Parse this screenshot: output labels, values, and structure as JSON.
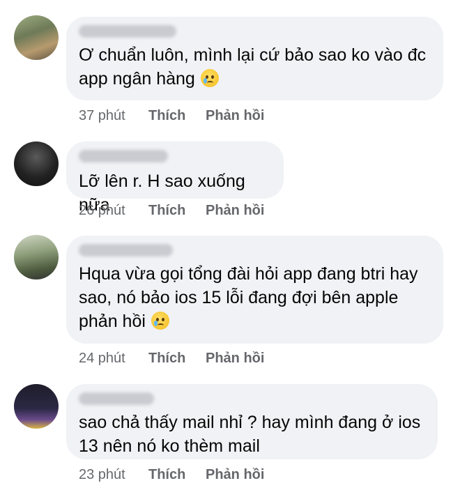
{
  "comments": [
    {
      "text_lines": [
        "Ơ chuẩn luôn, mình lại cứ bảo sao ko vào đc",
        "app ngân hàng"
      ],
      "emoji": "crying-face-emoji",
      "time": "37 phút",
      "like_label": "Thích",
      "reply_label": "Phản hồi"
    },
    {
      "text_lines": [
        "Lỡ lên r. H sao xuống nữa"
      ],
      "time": "26 phút",
      "like_label": "Thích",
      "reply_label": "Phản hồi"
    },
    {
      "text_lines": [
        "Hqua vừa gọi tổng đài hỏi app đang btri hay",
        "sao, nó bảo ios 15 lỗi đang đợi bên apple",
        "phản hồi"
      ],
      "emoji": "crying-face-emoji",
      "time": "24 phút",
      "like_label": "Thích",
      "reply_label": "Phản hồi"
    },
    {
      "text_lines": [
        "sao chả thấy mail nhỉ ? hay mình đang ở ios",
        "13 nên nó ko thèm mail"
      ],
      "time": "23 phút",
      "like_label": "Thích",
      "reply_label": "Phản hồi"
    }
  ],
  "colors": {
    "bubble": "#f0f2f5",
    "text": "#050505",
    "meta": "#65676b"
  }
}
